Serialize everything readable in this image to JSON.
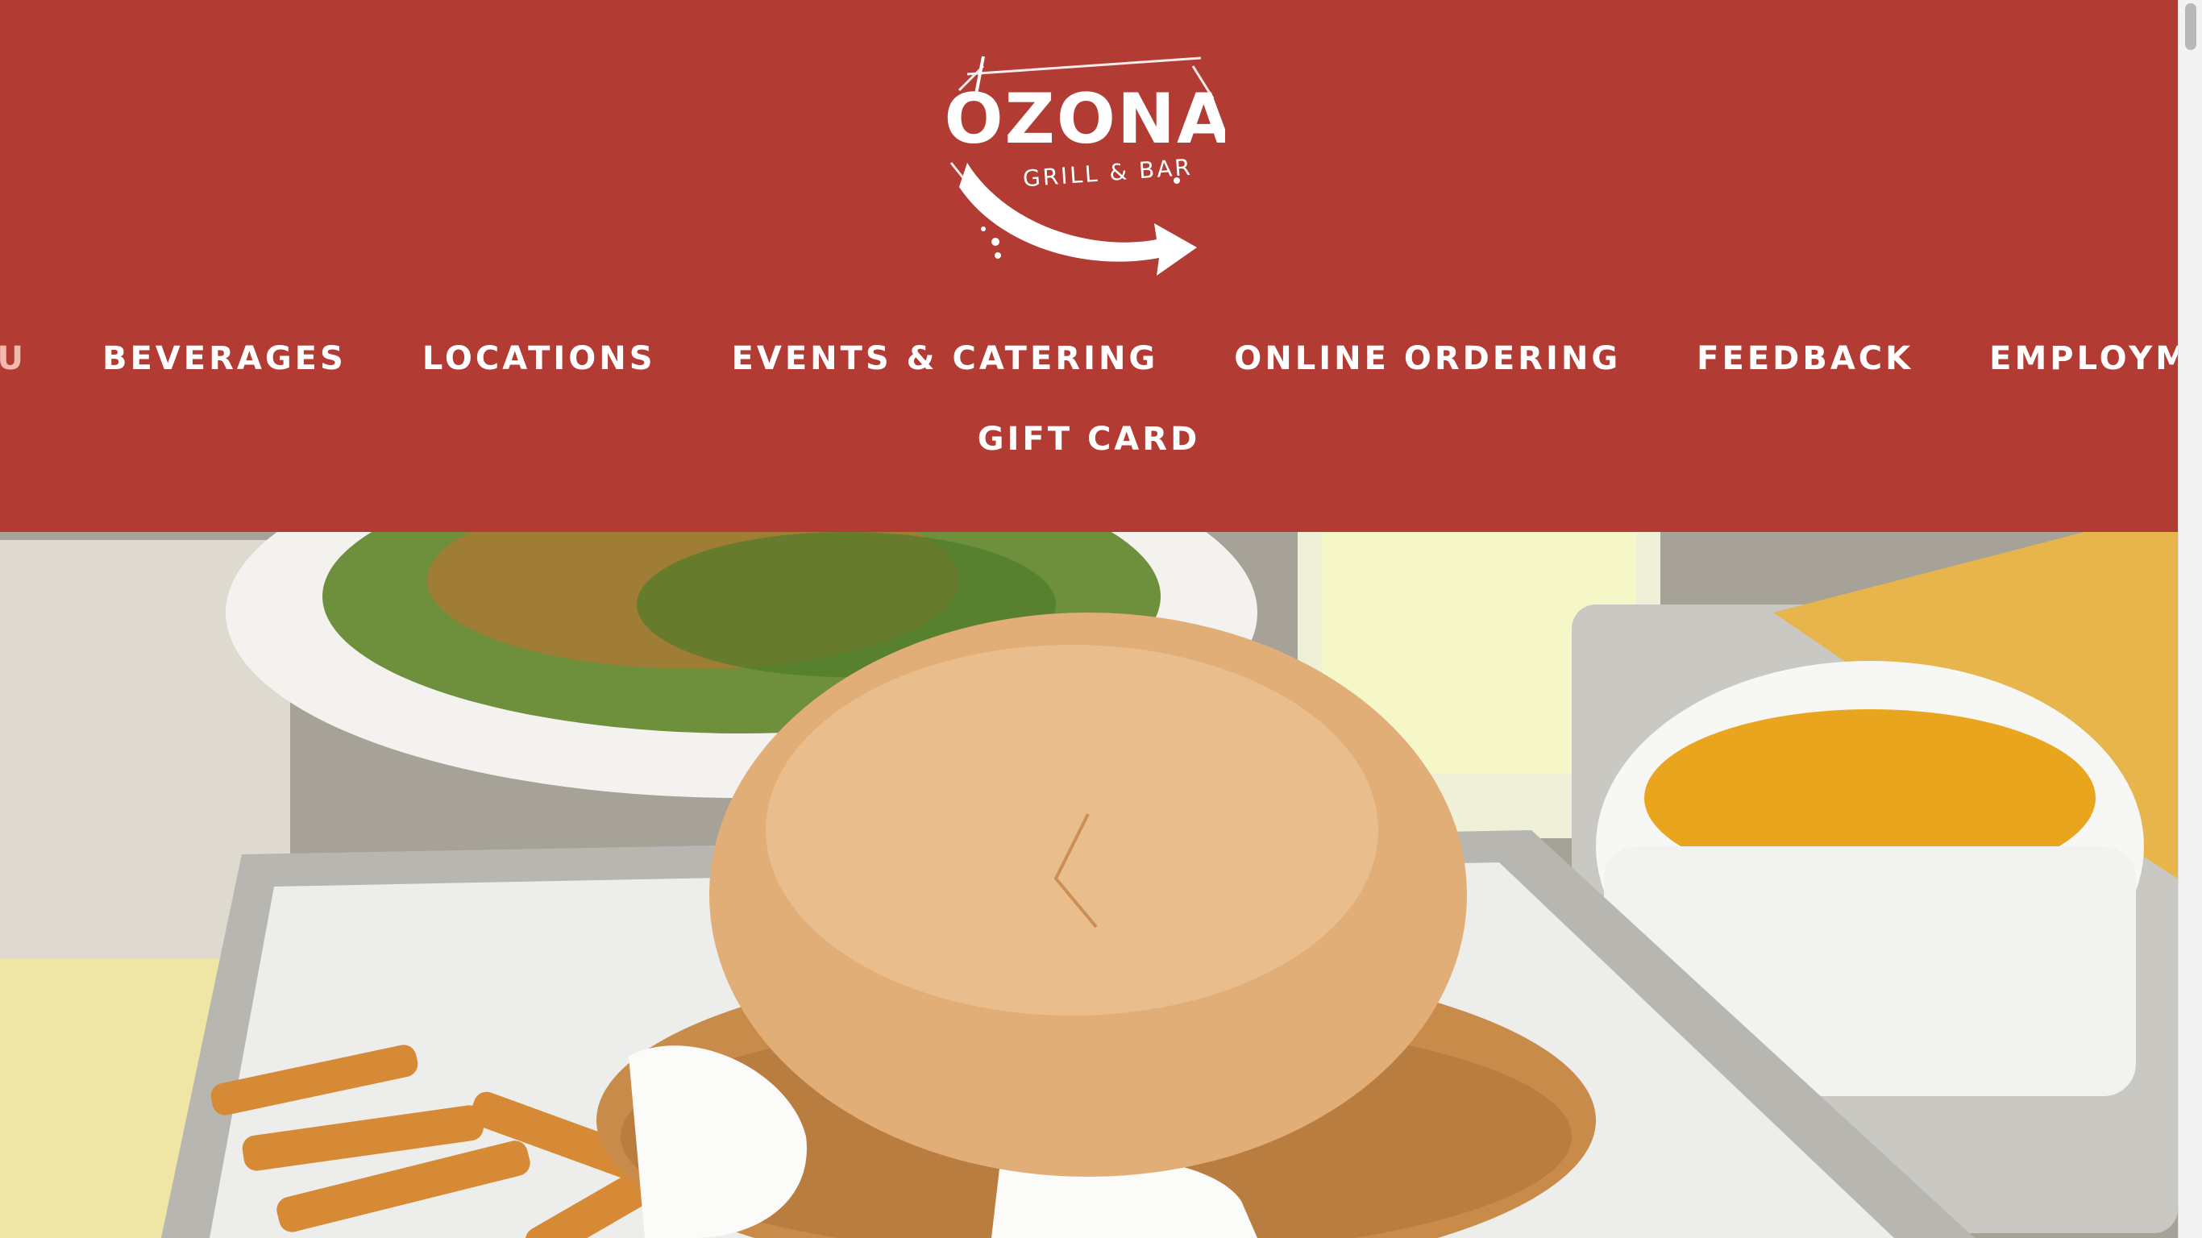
{
  "brand": {
    "logo_text": "OZONA",
    "logo_subtext": "GRILL & BAR",
    "colors": {
      "header_bg": "#b23b34",
      "nav_text": "#ffffff",
      "nav_active": "#f1b9b0"
    }
  },
  "nav": {
    "items": [
      {
        "label": "MENU",
        "active": true
      },
      {
        "label": "BEVERAGES",
        "active": false
      },
      {
        "label": "LOCATIONS",
        "active": false
      },
      {
        "label": "EVENTS & CATERING",
        "active": false
      },
      {
        "label": "ONLINE ORDERING",
        "active": false
      },
      {
        "label": "FEEDBACK",
        "active": false
      },
      {
        "label": "EMPLOYMENT",
        "active": false
      }
    ],
    "second_row": [
      {
        "label": "GIFT CARD",
        "active": false
      }
    ]
  },
  "hero": {
    "image_subject": "food-photo"
  }
}
